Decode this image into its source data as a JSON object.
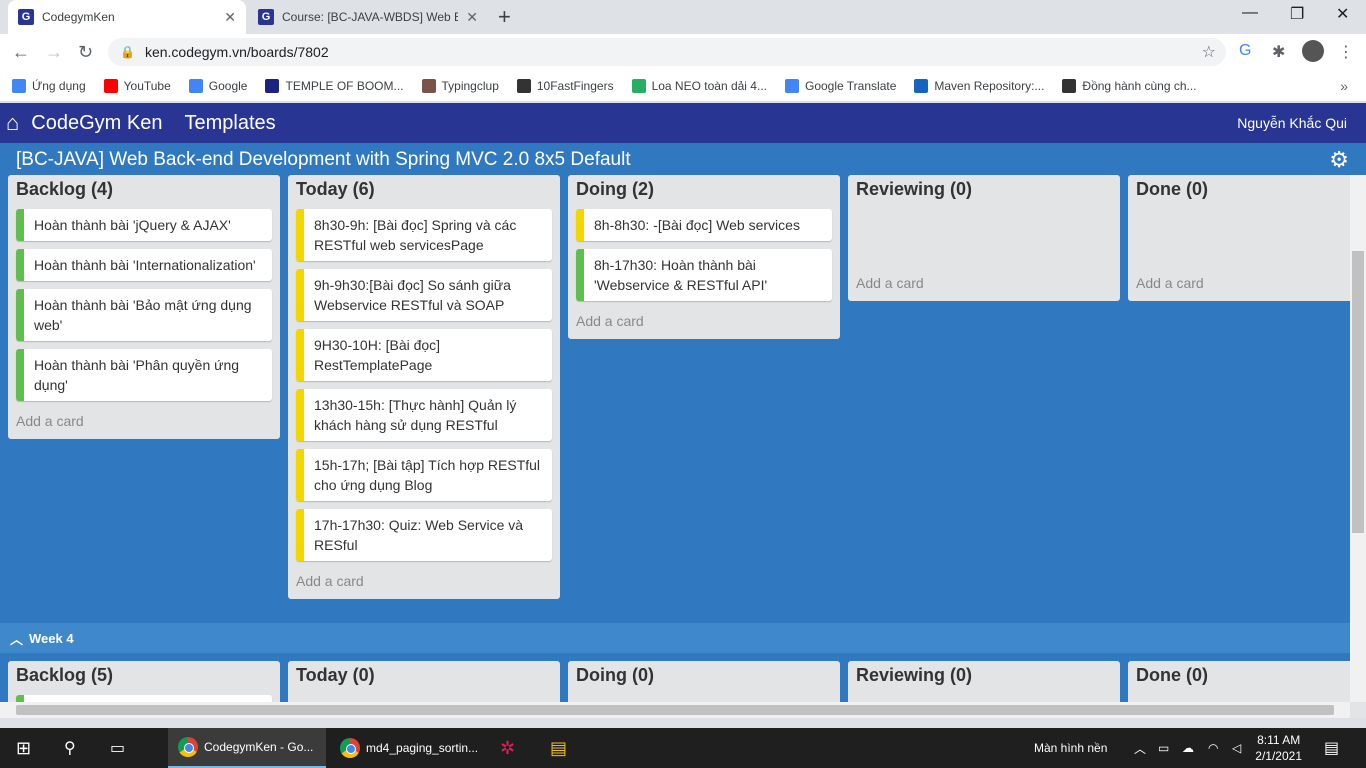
{
  "browser": {
    "tabs": [
      {
        "title": "CodegymKen"
      },
      {
        "title": "Course: [BC-JAVA-WBDS] Web Ba..."
      }
    ],
    "url": "ken.codegym.vn/boards/7802",
    "bookmarks": [
      {
        "label": "Ứng dụng",
        "color": "#4285f4"
      },
      {
        "label": "YouTube",
        "color": "#ff0000"
      },
      {
        "label": "Google",
        "color": "#4285f4"
      },
      {
        "label": "TEMPLE OF BOOM...",
        "color": "#1a237e"
      },
      {
        "label": "Typingclup",
        "color": "#795548"
      },
      {
        "label": "10FastFingers",
        "color": "#333333"
      },
      {
        "label": "Loa NEO toàn dải 4...",
        "color": "#27ae60"
      },
      {
        "label": "Google Translate",
        "color": "#4285f4"
      },
      {
        "label": "Maven Repository:...",
        "color": "#1565c0"
      },
      {
        "label": "Đồng hành cùng ch...",
        "color": "#333333"
      }
    ]
  },
  "app": {
    "brand": "CodeGym Ken",
    "templates": "Templates",
    "user": "Nguyễn Khắc Qui",
    "board_title": "[BC-JAVA] Web Back-end Development with Spring MVC 2.0 8x5 Default",
    "add_card": "Add a card",
    "week_label": "Week 4",
    "colors": {
      "green_label": "#61bd4f",
      "yellow_label": "#f2d600",
      "header": "#283593",
      "board": "#3079c0"
    }
  },
  "week3": {
    "lists": [
      {
        "title": "Backlog (4)",
        "cards": [
          {
            "text": "Hoàn thành bài 'jQuery & AJAX'",
            "label": "green"
          },
          {
            "text": "Hoàn thành bài 'Internationalization'",
            "label": "green"
          },
          {
            "text": "Hoàn thành bài 'Bảo mật ứng dụng web'",
            "label": "green"
          },
          {
            "text": "Hoàn thành bài 'Phân quyền ứng dụng'",
            "label": "green"
          }
        ]
      },
      {
        "title": "Today (6)",
        "cards": [
          {
            "text": "8h30-9h: [Bài đọc] Spring và các RESTful web servicesPage",
            "label": "yellow"
          },
          {
            "text": "9h-9h30:[Bài đọc] So sánh giữa Webservice RESTful và SOAP",
            "label": "yellow"
          },
          {
            "text": "9H30-10H: [Bài đọc] RestTemplatePage",
            "label": "yellow"
          },
          {
            "text": "13h30-15h: [Thực hành] Quản lý khách hàng sử dụng RESTful",
            "label": "yellow"
          },
          {
            "text": "15h-17h; [Bài tập] Tích hợp RESTful cho ứng dụng Blog",
            "label": "yellow"
          },
          {
            "text": "17h-17h30: Quiz: Web Service và RESful",
            "label": "yellow"
          }
        ]
      },
      {
        "title": "Doing (2)",
        "cards": [
          {
            "text": "8h-8h30: -[Bài đọc] Web services",
            "label": "yellow"
          },
          {
            "text": "8h-17h30: Hoàn thành bài 'Webservice & RESTful API'",
            "label": "green"
          }
        ]
      },
      {
        "title": "Reviewing (0)",
        "cards": []
      },
      {
        "title": "Done (0)",
        "cards": []
      }
    ]
  },
  "week4": {
    "lists": [
      {
        "title": "Backlog (5)"
      },
      {
        "title": "Today (0)"
      },
      {
        "title": "Doing (0)"
      },
      {
        "title": "Reviewing (0)"
      },
      {
        "title": "Done (0)"
      }
    ]
  },
  "taskbar": {
    "apps": [
      {
        "label": "CodegymKen - Go..."
      },
      {
        "label": "md4_paging_sortin..."
      }
    ],
    "tray_label": "Màn hình nền",
    "time": "8:11 AM",
    "date": "2/1/2021"
  }
}
